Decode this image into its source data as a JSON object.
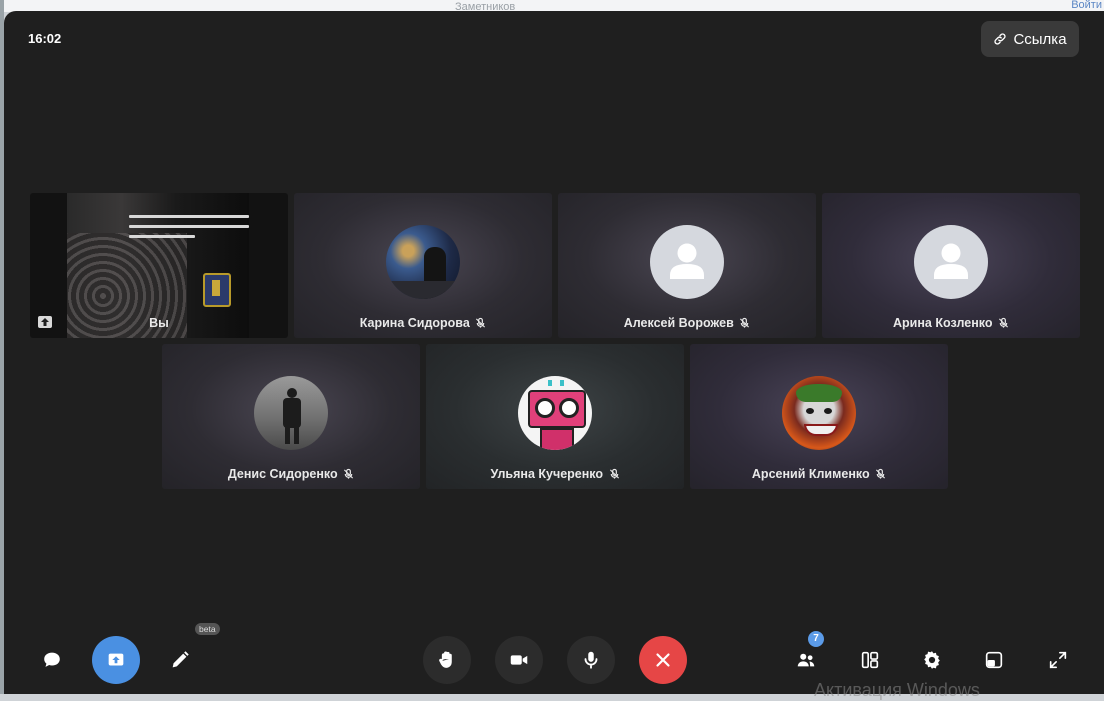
{
  "background_page": {
    "link_text": "Войти",
    "faded_text": "Заметников"
  },
  "call": {
    "time": "16:02",
    "link_button": "Ссылка",
    "self_label": "Вы",
    "participants": [
      {
        "name": "Карина Сидорова",
        "muted": true,
        "avatar": "photo"
      },
      {
        "name": "Алексей Ворожев",
        "muted": true,
        "avatar": "placeholder"
      },
      {
        "name": "Арина Козленко",
        "muted": true,
        "avatar": "placeholder"
      },
      {
        "name": "Денис Сидоренко",
        "muted": true,
        "avatar": "photo"
      },
      {
        "name": "Ульяна Кучеренко",
        "muted": true,
        "avatar": "photo"
      },
      {
        "name": "Арсений Клименко",
        "muted": true,
        "avatar": "photo"
      }
    ]
  },
  "toolbar": {
    "beta_label": "beta",
    "participants_count": "7",
    "left_icons": [
      "chat-icon",
      "screen-share-icon",
      "pencil-icon"
    ],
    "center_icons": [
      "raise-hand-icon",
      "camera-icon",
      "microphone-icon",
      "end-call-icon"
    ],
    "right_icons": [
      "participants-icon",
      "layout-icon",
      "settings-icon",
      "pip-icon",
      "fullscreen-icon"
    ]
  },
  "system_watermark": "Активация Windows",
  "colors": {
    "accent_blue": "#4a90e2",
    "end_call_red": "#e64646",
    "window_bg": "#1f1f1f"
  }
}
